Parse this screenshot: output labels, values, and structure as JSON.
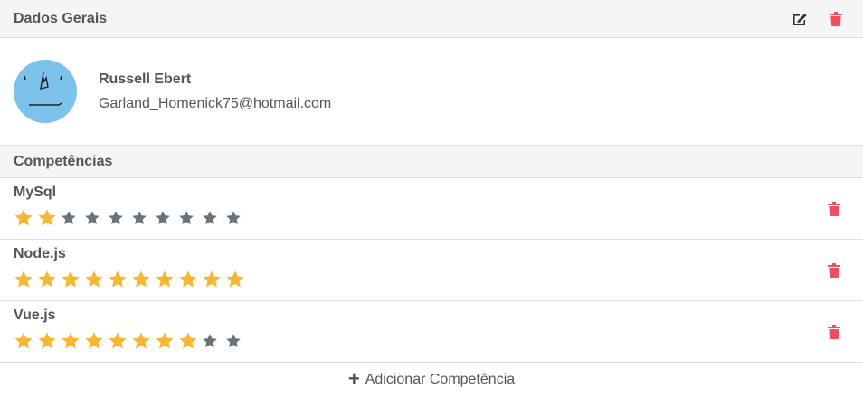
{
  "general": {
    "title": "Dados Gerais",
    "edit_icon": "edit-icon",
    "delete_icon": "trash-icon"
  },
  "profile": {
    "name": "Russell Ebert",
    "email": "Garland_Homenick75@hotmail.com",
    "avatar_color": "#7cc2ea"
  },
  "competencias": {
    "title": "Competências",
    "max_rating": 10,
    "items": [
      {
        "name": "MySql",
        "rating": 2
      },
      {
        "name": "Node.js",
        "rating": 10
      },
      {
        "name": "Vue.js",
        "rating": 8
      }
    ]
  },
  "add": {
    "label": "Adicionar Competência"
  },
  "colors": {
    "star_filled": "#f7b733",
    "star_empty": "#66727c",
    "danger": "#f04e5e",
    "header_bg": "#f5f5f5",
    "text": "#555555"
  }
}
